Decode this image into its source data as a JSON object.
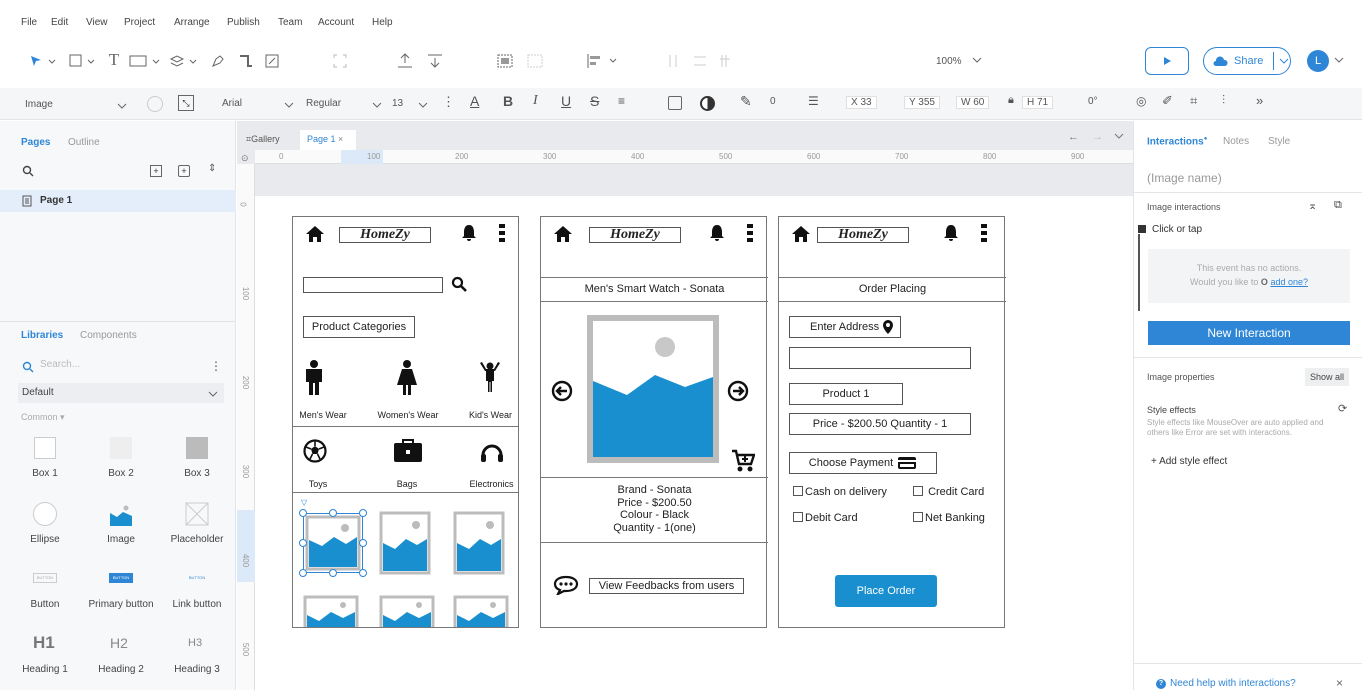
{
  "menu": [
    "File",
    "Edit",
    "View",
    "Project",
    "Arrange",
    "Publish",
    "Team",
    "Account",
    "Help"
  ],
  "toolbar": {
    "zoom": "100%",
    "share_label": "Share",
    "avatar_initial": "L"
  },
  "format_bar": {
    "element_type": "Image",
    "font": "Arial",
    "weight": "Regular",
    "size": "13",
    "line_value": "0",
    "x": "X 33",
    "y": "Y 355",
    "w": "W 60",
    "h": "H 71",
    "rotation": "0°"
  },
  "tabs": {
    "gallery": "Gallery",
    "page1": "Page 1"
  },
  "ruler": {
    "h": [
      "0",
      "100",
      "200",
      "300",
      "400",
      "500",
      "600",
      "700",
      "800",
      "900"
    ],
    "v": [
      "0",
      "100",
      "200",
      "300",
      "400",
      "500"
    ]
  },
  "left": {
    "pages_tab": "Pages",
    "outline_tab": "Outline",
    "page_item": "Page 1",
    "libraries_tab": "Libraries",
    "components_tab": "Components",
    "search_placeholder": "Search...",
    "library_select": "Default",
    "common_label": "Common",
    "items": [
      {
        "label": "Box 1"
      },
      {
        "label": "Box 2"
      },
      {
        "label": "Box 3"
      },
      {
        "label": "Ellipse"
      },
      {
        "label": "Image"
      },
      {
        "label": "Placeholder"
      },
      {
        "label": "Button"
      },
      {
        "label": "Primary button"
      },
      {
        "label": "Link button"
      },
      {
        "label": "Heading 1",
        "glyph": "H1"
      },
      {
        "label": "Heading 2",
        "glyph": "H2"
      },
      {
        "label": "Heading 3",
        "glyph": "H3"
      }
    ],
    "button_thumb": "BUTTON"
  },
  "right": {
    "tab_interactions": "Interactions",
    "tab_notes": "Notes",
    "tab_style": "Style",
    "image_name_placeholder": "(Image name)",
    "image_interactions": "Image interactions",
    "click_or_tap": "Click or tap",
    "no_actions_1": "This event has no actions.",
    "no_actions_2": "Would you like to",
    "add_one": "add one?",
    "new_interaction": "New Interaction",
    "image_properties": "Image properties",
    "show_all": "Show all",
    "style_effects": "Style effects",
    "style_effects_desc": "Style effects like MouseOver are auto applied and others like Error are set with interactions.",
    "add_style_effect": "+ Add style effect",
    "help": "Need help with interactions?"
  },
  "screen1": {
    "logo": "HomeZy",
    "product_categories": "Product Categories",
    "categories": [
      "Men's Wear",
      "Women's Wear",
      "Kid's Wear",
      "Toys",
      "Bags",
      "Electronics"
    ]
  },
  "screen2": {
    "logo": "HomeZy",
    "product_title": "Men's Smart Watch - Sonata",
    "details": [
      "Brand - Sonata",
      "Price - $200.50",
      "Colour - Black",
      "Quantity - 1(one)"
    ],
    "feedback": "View Feedbacks from users"
  },
  "screen3": {
    "logo": "HomeZy",
    "title": "Order Placing",
    "enter_address": "Enter Address",
    "product": "Product 1",
    "price_qty": "Price - $200.50  Quantity - 1",
    "choose_payment": "Choose Payment",
    "options": [
      "Cash on delivery",
      "Credit Card",
      "Debit Card",
      "Net Banking"
    ],
    "place_order": "Place Order"
  },
  "colors": {
    "accent": "#2f86d6",
    "image_blue": "#1a8fd0"
  }
}
